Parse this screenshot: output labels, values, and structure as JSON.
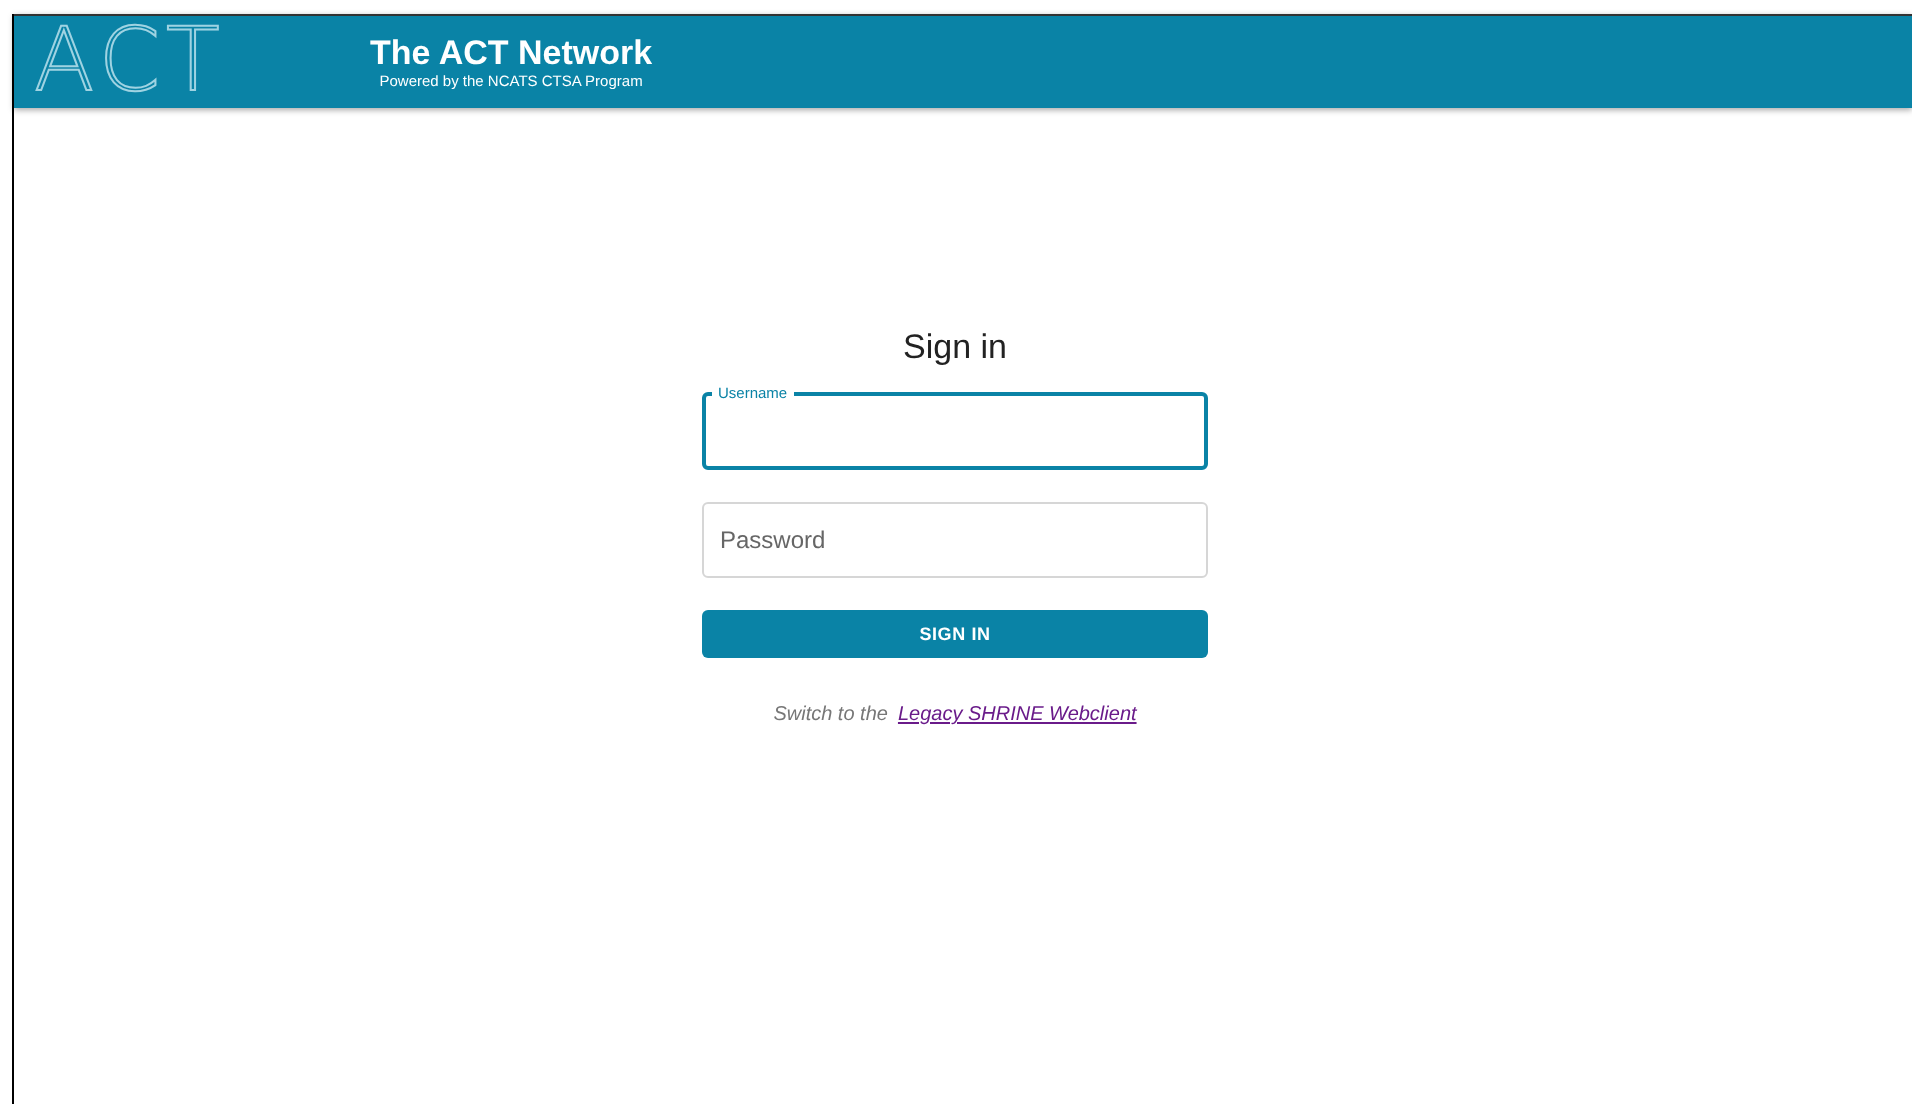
{
  "header": {
    "logo": "ACT",
    "title": "The ACT Network",
    "subtitle": "Powered by the NCATS CTSA Program"
  },
  "form": {
    "heading": "Sign in",
    "fields": [
      {
        "kind": "outlined",
        "label": "Username",
        "focused": true
      },
      {
        "kind": "placeholder",
        "placeholder": "Password",
        "focused": false
      }
    ],
    "button": "SIGN IN",
    "switch_text": "Switch to the",
    "switch_link": "Legacy SHRINE Webclient"
  }
}
